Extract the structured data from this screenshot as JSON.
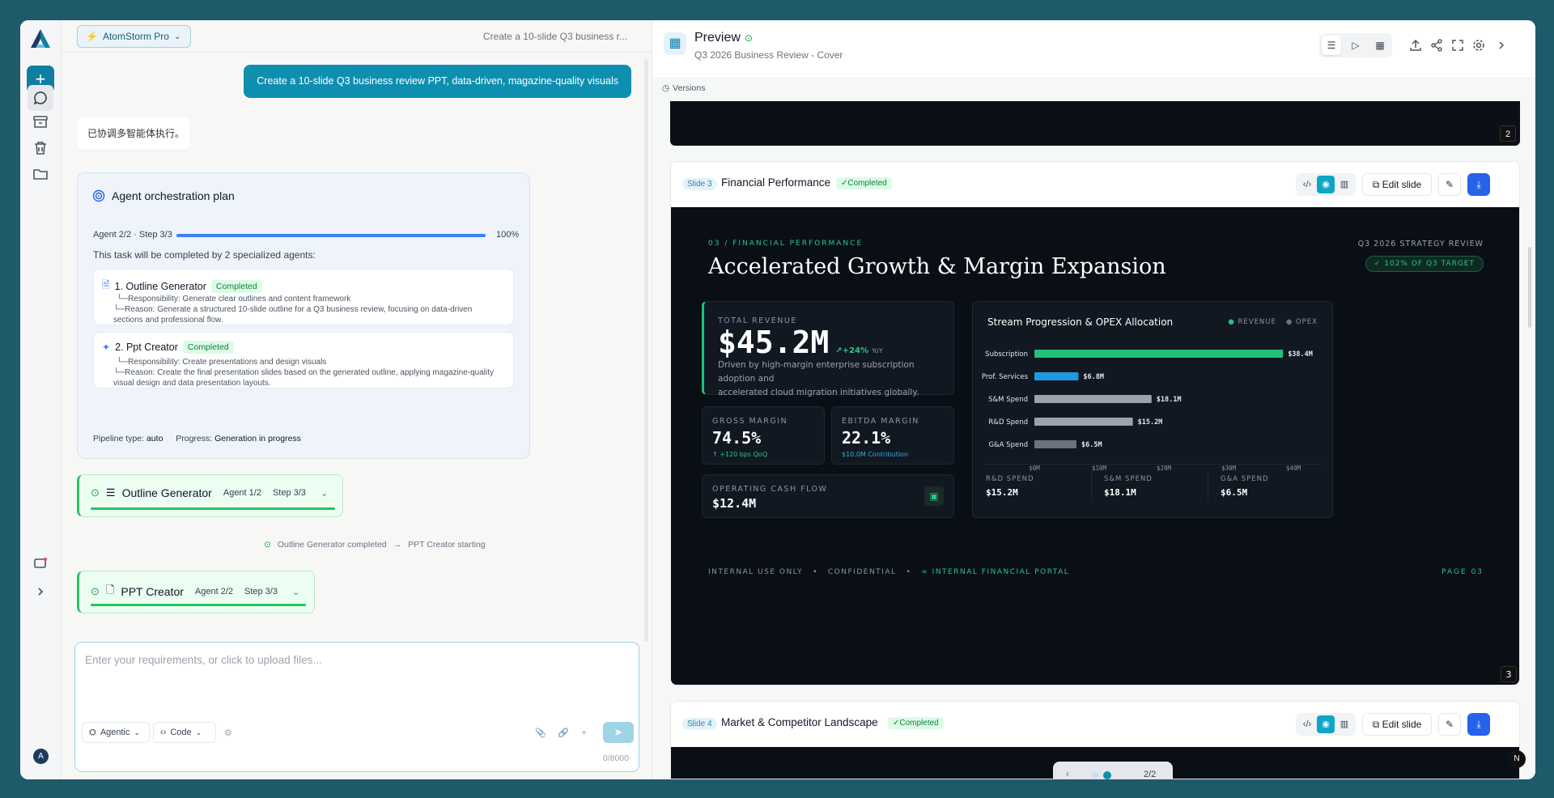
{
  "rail": {
    "avatar": "A"
  },
  "chat": {
    "model": "AtomStorm Pro",
    "title": "Create a 10-slide Q3 business r...",
    "user_message": "Create a 10-slide Q3 business review PPT, data-driven, magazine-quality visuals",
    "ai_message": "已协调多智能体执行。",
    "plan": {
      "title": "Agent orchestration plan",
      "progress_label": "Agent 2/2 · Step 3/3",
      "progress": 1.0,
      "percent": "100%",
      "description": "This task will be completed by 2 specialized agents:",
      "agents": [
        {
          "name": "1. Outline Generator",
          "status": "Completed",
          "responsibility": "└─Responsibility: Generate clear outlines and content framework",
          "reason": "└─Reason: Generate a structured 10-slide outline for a Q3 business review, focusing on data-driven sections and professional flow."
        },
        {
          "name": "2. Ppt Creator",
          "status": "Completed",
          "responsibility": "└─Responsibility: Create presentations and design visuals",
          "reason": "└─Reason: Create the final presentation slides based on the generated outline, applying magazine-quality visual design and data presentation layouts."
        }
      ],
      "pipeline_label": "Pipeline type:",
      "pipeline_value": "auto",
      "progress_state_label": "Progress:",
      "progress_state_value": "Generation in progress"
    },
    "steps": [
      {
        "name": "Outline Generator",
        "agent": "Agent 1/2",
        "step": "Step 3/3"
      },
      {
        "name": "PPT Creator",
        "agent": "Agent 2/2",
        "step": "Step 3/3"
      }
    ],
    "transition": {
      "from": "Outline Generator completed",
      "arrow": "→",
      "to": "PPT Creator starting"
    },
    "composer": {
      "placeholder": "Enter your requirements, or click to upload files...",
      "mode": "Agentic",
      "code": "Code",
      "counter": "0/8000"
    }
  },
  "preview": {
    "title": "Preview",
    "subtitle": "Q3 2026 Business Review - Cover",
    "versions": "Versions",
    "prev_slide_number": "2",
    "edit_label": "Edit slide",
    "slides": [
      {
        "tag": "Slide 3",
        "name": "Financial Performance",
        "status": "✓Completed",
        "number": "3"
      },
      {
        "tag": "Slide 4",
        "name": "Market & Competitor Landscape",
        "status": "✓Completed"
      }
    ],
    "pager": "2/2",
    "n_badge": "N"
  },
  "slide3": {
    "kicker": "03 / FINANCIAL PERFORMANCE",
    "title": "Accelerated Growth & Margin Expansion",
    "review": "Q3 2026 STRATEGY REVIEW",
    "target": "✓ 102% OF Q3 TARGET",
    "revenue": {
      "label": "TOTAL REVENUE",
      "value": "$45.2M",
      "delta": "↗+24%",
      "delta_unit": "YoY",
      "desc1": "Driven by high-margin enterprise subscription adoption and",
      "desc2": "accelerated cloud migration initiatives globally."
    },
    "gross": {
      "label": "GROSS MARGIN",
      "value": "74.5%",
      "note": "↑ +120 bps QoQ"
    },
    "ebitda": {
      "label": "EBITDA MARGIN",
      "value": "22.1%",
      "note": "$10.0M Contribution"
    },
    "cash": {
      "label": "OPERATING CASH FLOW",
      "value": "$12.4M"
    },
    "chart_title": "Stream Progression & OPEX Allocation",
    "legend": [
      "REVENUE",
      "OPEX"
    ],
    "spend": [
      {
        "label": "R&D SPEND",
        "value": "$15.2M"
      },
      {
        "label": "S&M SPEND",
        "value": "$18.1M"
      },
      {
        "label": "G&A SPEND",
        "value": "$6.5M"
      }
    ],
    "footer": [
      "INTERNAL USE ONLY",
      "CONFIDENTIAL",
      "∞ INTERNAL FINANCIAL PORTAL"
    ],
    "page": "PAGE 03"
  },
  "chart_data": {
    "type": "bar",
    "orientation": "horizontal",
    "title": "Stream Progression & OPEX Allocation",
    "categories": [
      "Subscription",
      "Prof. Services",
      "S&M Spend",
      "R&D Spend",
      "G&A Spend"
    ],
    "values": [
      38.4,
      6.8,
      18.1,
      15.2,
      6.5
    ],
    "value_labels": [
      "$38.4M",
      "$6.8M",
      "$18.1M",
      "$15.2M",
      "$6.5M"
    ],
    "colors": [
      "#22c07a",
      "#1e9be0",
      "#9ca3af",
      "#9ca3af",
      "#6b7280"
    ],
    "xlim": [
      0,
      40
    ],
    "xticks": [
      "$0M",
      "$10M",
      "$20M",
      "$30M",
      "$40M"
    ],
    "legend_position": "top-right"
  }
}
